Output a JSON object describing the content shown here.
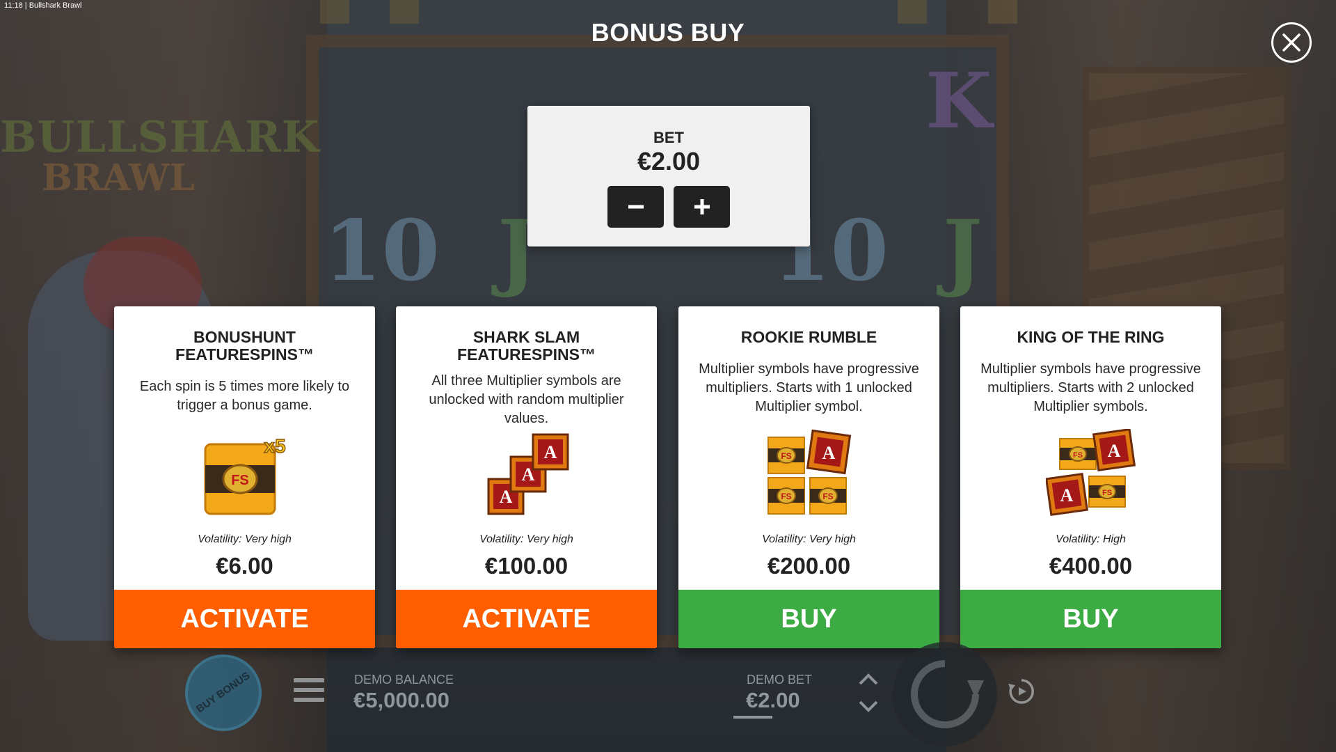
{
  "status_bar": {
    "time": "11:18",
    "separator": "|",
    "app_name": "Bullshark Brawl"
  },
  "background": {
    "logo_line1": "BULLSHARK",
    "logo_line2": "BRAWL",
    "reel_symbols": [
      "10",
      "J",
      "10",
      "J",
      "K"
    ]
  },
  "overlay": {
    "title": "BONUS BUY",
    "close_icon": "close-icon"
  },
  "bet": {
    "label": "BET",
    "value": "€2.00",
    "decrease_icon": "minus-icon",
    "increase_icon": "plus-icon"
  },
  "cards": [
    {
      "name": "BONUSHUNT FEATURESPINS™",
      "description": "Each spin is 5 times more likely to trigger a bonus game.",
      "art_label": "FS",
      "art_multiplier": "x5",
      "volatility": "Volatility: Very high",
      "price": "€6.00",
      "action": "ACTIVATE",
      "action_color": "#ff5e00"
    },
    {
      "name": "SHARK SLAM FEATURESPINS™",
      "description": "All three Multiplier symbols are unlocked with random multiplier values.",
      "art_label": "A",
      "volatility": "Volatility: Very high",
      "price": "€100.00",
      "action": "ACTIVATE",
      "action_color": "#ff5e00"
    },
    {
      "name": "ROOKIE RUMBLE",
      "description": "Multiplier symbols have progressive multipliers. Starts with 1 unlocked Multiplier symbol.",
      "art_label": "FS",
      "art_label2": "A",
      "volatility": "Volatility: Very high",
      "price": "€200.00",
      "action": "BUY",
      "action_color": "#3cab43"
    },
    {
      "name": "KING OF THE RING",
      "description": "Multiplier symbols have progressive multipliers. Starts with 2 unlocked Multiplier symbols.",
      "art_label": "FS",
      "art_label2": "A",
      "volatility": "Volatility: High",
      "price": "€400.00",
      "action": "BUY",
      "action_color": "#3cab43"
    }
  ],
  "bottom_bar": {
    "buy_bonus_label": "BUY BONUS",
    "menu_icon": "hamburger-icon",
    "balance_label": "DEMO BALANCE",
    "balance_value": "€5,000.00",
    "bet_label": "DEMO BET",
    "bet_value": "€2.00",
    "spin_icon": "spin-icon",
    "autoplay_icon": "autoplay-icon"
  }
}
